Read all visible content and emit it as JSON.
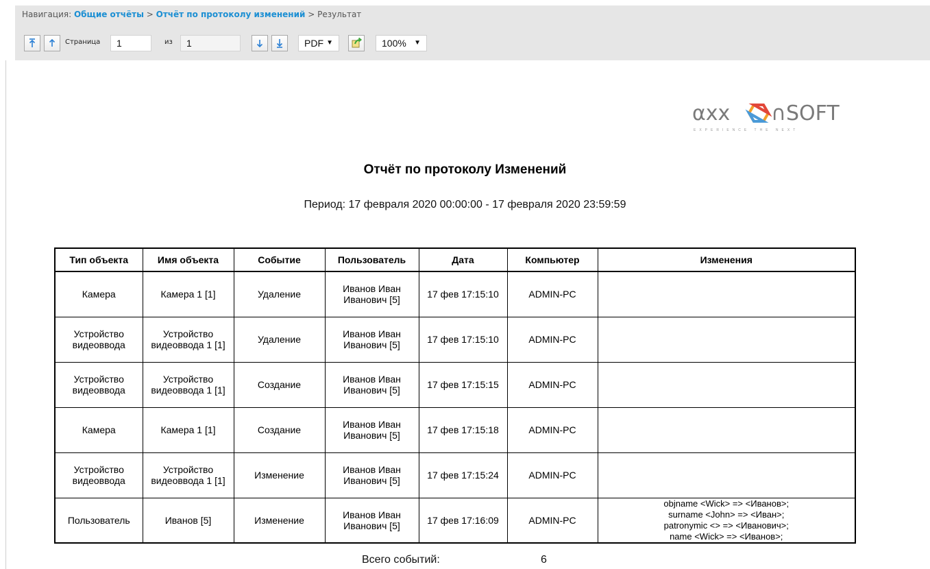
{
  "nav": {
    "prefix": "Навигация:",
    "link1": "Общие отчёты",
    "sep1": ">",
    "link2": "Отчёт по протоколу изменений",
    "sep2": ">",
    "current": "Результат"
  },
  "toolbar": {
    "page_label": "Страница",
    "page_value": "1",
    "of_label": "из",
    "total_pages": "1",
    "format_value": "PDF",
    "zoom_value": "100%"
  },
  "report": {
    "logo": {
      "word": "axxonsoft",
      "tagline": "EXPERIENCE THE NEXT"
    },
    "title": "Отчёт по протоколу Изменений",
    "period": "Период: 17 февраля 2020 00:00:00 - 17 февраля 2020 23:59:59",
    "columns": [
      "Тип объекта",
      "Имя объекта",
      "Событие",
      "Пользователь",
      "Дата",
      "Компьютер",
      "Изменения"
    ],
    "rows": [
      [
        "Камера",
        "Камера 1 [1]",
        "Удаление",
        "Иванов Иван\nИванович [5]",
        "17 фев 17:15:10",
        "ADMIN-PC",
        ""
      ],
      [
        "Устройство\nвидеоввода",
        "Устройство\nвидеоввода 1 [1]",
        "Удаление",
        "Иванов Иван\nИванович [5]",
        "17 фев 17:15:10",
        "ADMIN-PC",
        ""
      ],
      [
        "Устройство\nвидеоввода",
        "Устройство\nвидеоввода 1 [1]",
        "Создание",
        "Иванов Иван\nИванович [5]",
        "17 фев 17:15:15",
        "ADMIN-PC",
        ""
      ],
      [
        "Камера",
        "Камера 1 [1]",
        "Создание",
        "Иванов Иван\nИванович [5]",
        "17 фев 17:15:18",
        "ADMIN-PC",
        ""
      ],
      [
        "Устройство\nвидеоввода",
        "Устройство\nвидеоввода 1 [1]",
        "Изменение",
        "Иванов Иван\nИванович [5]",
        "17 фев 17:15:24",
        "ADMIN-PC",
        ""
      ],
      [
        "Пользователь",
        "Иванов [5]",
        "Изменение",
        "Иванов Иван\nИванович [5]",
        "17 фев 17:16:09",
        "ADMIN-PC",
        "objname <Wick> => <Иванов>;\nsurname <John> => <Иван>;\npatronymic <> => <Иванович>;\nname <Wick> => <Иванов>;"
      ]
    ],
    "total_label": "Всего событий:",
    "total_value": "6"
  },
  "colors": {
    "nav_link": "#1c8fd3",
    "toolbar_bg": "#e6e6e6",
    "icon_blue": "#2a7fd4",
    "icon_green": "#3ea83a"
  }
}
